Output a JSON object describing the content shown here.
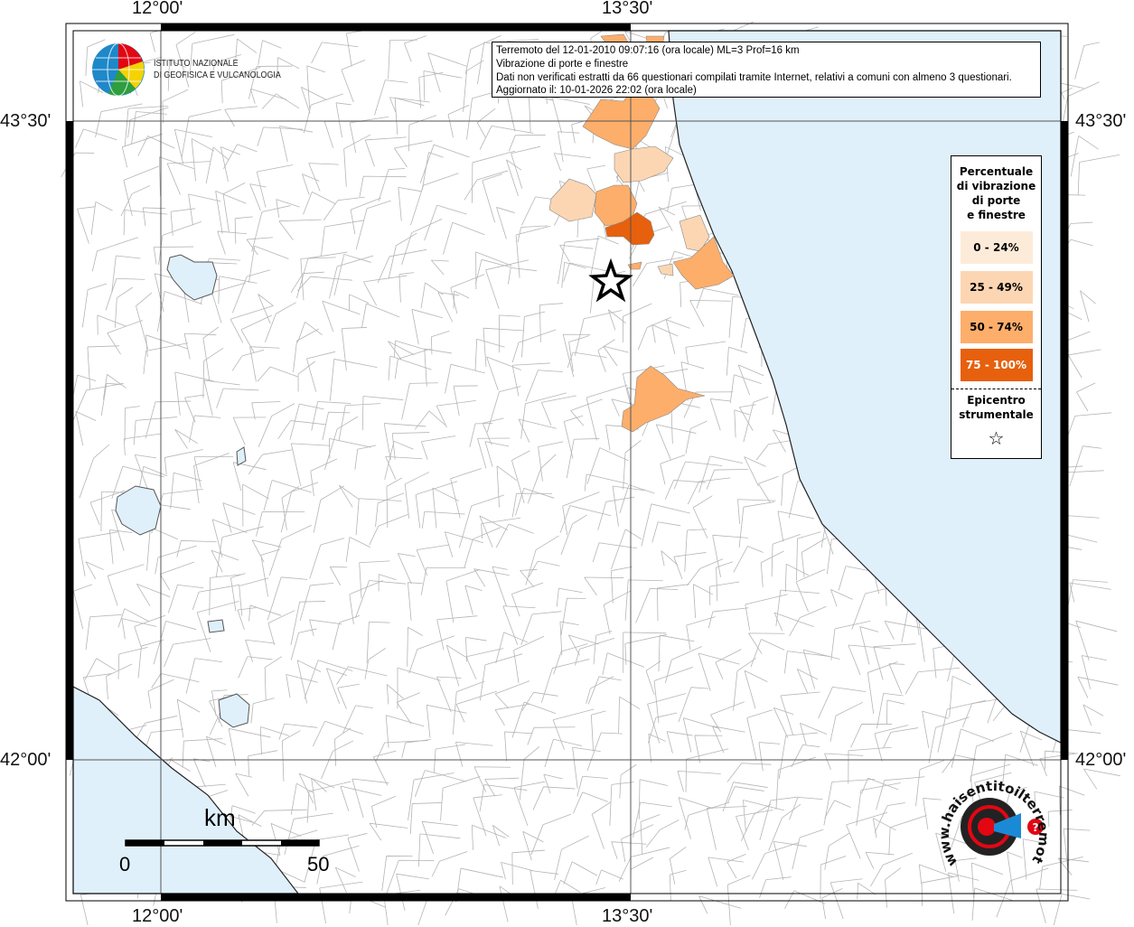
{
  "info": {
    "line1": "Terremoto del 12-01-2010 09:07:16 (ora locale) ML=3 Prof=16 km",
    "line2": "Vibrazione di porte e finestre",
    "line3": "Dati non verificati estratti da 66 questionari compilati tramite Internet, relativi a comuni con almeno 3 questionari.",
    "line4": "Aggiornato il: 10-01-2026 22:02 (ora locale)"
  },
  "logo": {
    "line1": "ISTITUTO NAZIONALE",
    "line2": "DI GEOFISICA E VULCANOLOGIA"
  },
  "axes": {
    "top": [
      "12°00'",
      "13°30'"
    ],
    "bottom": [
      "12°00'",
      "13°30'"
    ],
    "left": [
      "43°30'",
      "42°00'"
    ],
    "right": [
      "43°30'",
      "42°00'"
    ]
  },
  "legend": {
    "title": [
      "Percentuale",
      "di vibrazione",
      "di porte",
      "e finestre"
    ],
    "classes": [
      {
        "label": "0 - 24%",
        "color": "#fdebd9"
      },
      {
        "label": "25 - 49%",
        "color": "#fcd6b3"
      },
      {
        "label": "50 - 74%",
        "color": "#fdae6b"
      },
      {
        "label": "75 - 100%",
        "color": "#e6600d"
      }
    ],
    "epicenter": [
      "Epicentro",
      "strumentale"
    ],
    "star": "☆"
  },
  "scale": {
    "unit": "km",
    "min": "0",
    "max": "50"
  },
  "badge": {
    "text": "haisentitoilterremoto.it",
    "prefix": "www."
  },
  "colors": {
    "sea": "#dff0fb",
    "border": "#999999"
  }
}
